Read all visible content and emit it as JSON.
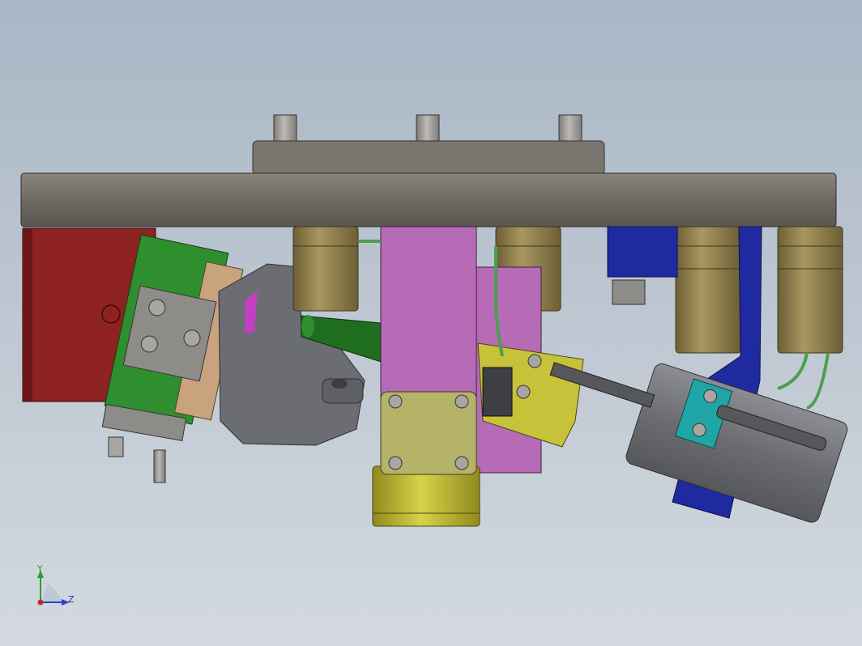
{
  "viewport": {
    "background_top": "#a9b6c5",
    "background_bottom": "#d3d9df"
  },
  "model": {
    "colors": {
      "base_plate": "#6e6a63",
      "flange": "#7a756e",
      "pins": "#9b9893",
      "red_block": "#8e2220",
      "green_block": "#2f8f2f",
      "tan_bracket": "#c9a37e",
      "gray_body": "#6b6d72",
      "magenta_column": "#b56bb5",
      "olive_bushing": "#8a7a4a",
      "blue_bracket": "#1f2aa0",
      "yellow_clamp": "#c8c23a",
      "dark_green_rod": "#1f6e1f",
      "gray_cylinder": "#76787d",
      "cyan_clamp": "#1fa5a5",
      "hose": "#4e9e4e"
    }
  },
  "triad": {
    "y_label": "Y",
    "z_label": "Z",
    "y_color": "#2e9e2e",
    "z_color": "#2b45c8",
    "origin_color": "#c62828",
    "icons": [
      "y-axis-arrow-icon",
      "z-axis-arrow-icon",
      "origin-dot-icon"
    ]
  }
}
